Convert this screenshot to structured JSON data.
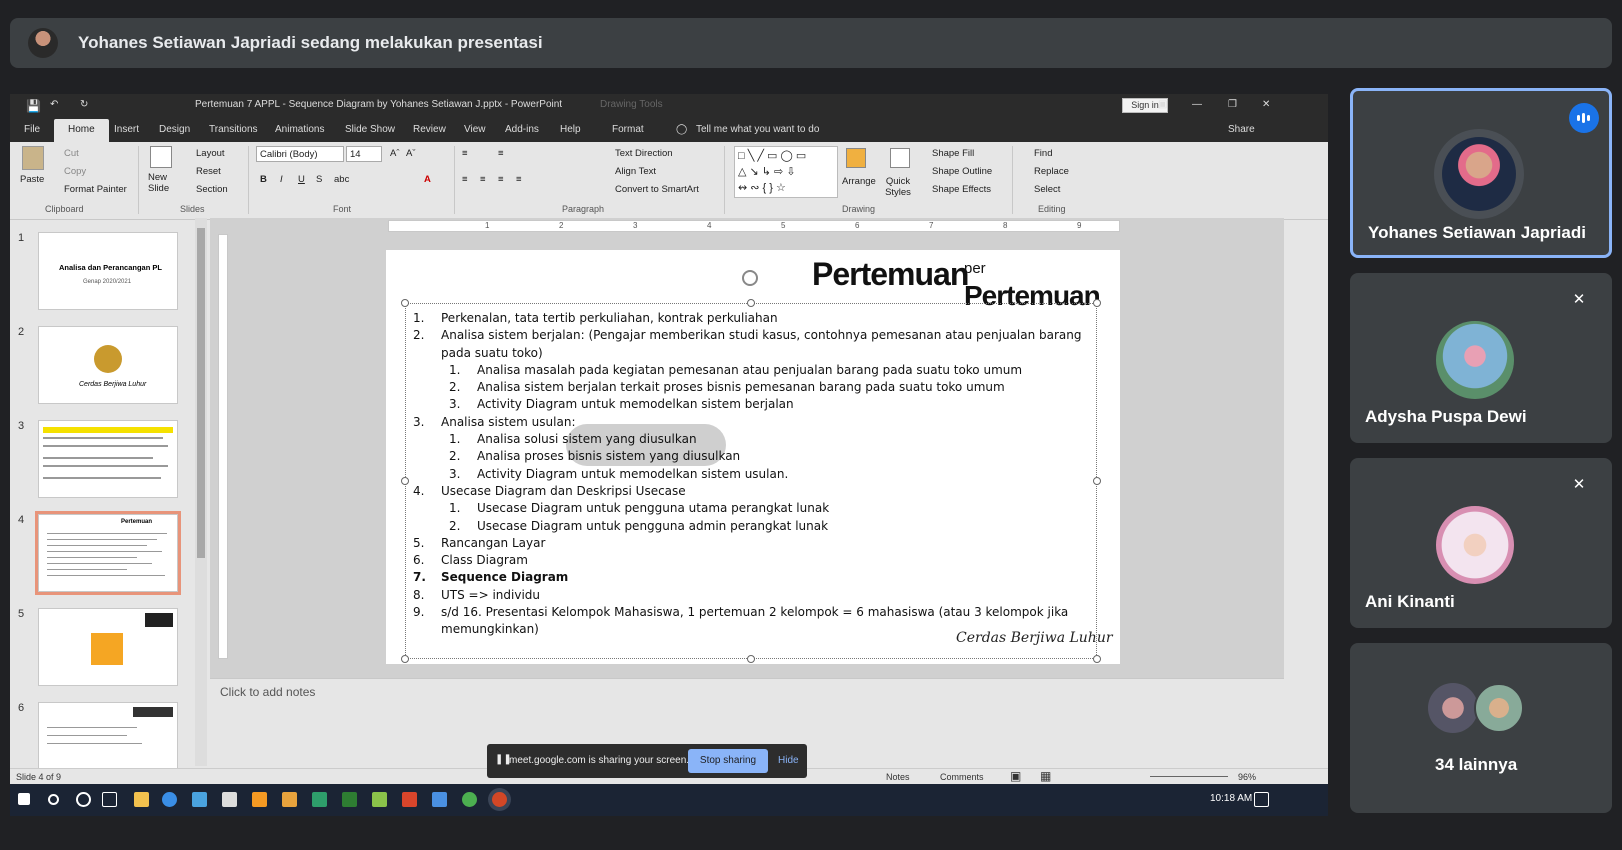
{
  "meet": {
    "presenter_banner": "Yohanes Setiawan Japriadi sedang melakukan presentasi",
    "share_bar": {
      "message": "meet.google.com is sharing your screen.",
      "stop": "Stop sharing",
      "hide": "Hide"
    },
    "participants": [
      {
        "name": "Yohanes Setiawan Japriadi",
        "speaking": true
      },
      {
        "name": "Adysha Puspa Dewi",
        "muted": true
      },
      {
        "name": "Ani Kinanti",
        "muted": true
      },
      {
        "name": "34 lainnya"
      }
    ]
  },
  "ppt": {
    "window_title": "Pertemuan 7 APPL - Sequence Diagram by Yohanes Setiawan J.pptx  -  PowerPoint",
    "drawing_tools": "Drawing Tools",
    "sign_in": "Sign in",
    "tabs": [
      "File",
      "Home",
      "Insert",
      "Design",
      "Transitions",
      "Animations",
      "Slide Show",
      "Review",
      "View",
      "Add-ins",
      "Help",
      "Format"
    ],
    "tell_me": "Tell me what you want to do",
    "share": "Share",
    "ribbon": {
      "cut": "Cut",
      "copy": "Copy",
      "format_painter": "Format Painter",
      "paste": "Paste",
      "new_slide": "New Slide",
      "layout": "Layout",
      "reset": "Reset",
      "section": "Section",
      "font_name": "Calibri (Body)",
      "font_size": "14",
      "text_direction": "Text Direction",
      "align_text": "Align Text",
      "convert": "Convert to SmartArt",
      "arrange": "Arrange",
      "quick_styles": "Quick Styles",
      "shape_fill": "Shape Fill",
      "shape_outline": "Shape Outline",
      "shape_effects": "Shape Effects",
      "find": "Find",
      "replace": "Replace",
      "select": "Select",
      "groups": [
        "Clipboard",
        "Slides",
        "Font",
        "Paragraph",
        "Drawing",
        "Editing"
      ]
    },
    "thumb_numbers": [
      "1",
      "2",
      "3",
      "4",
      "5",
      "6"
    ],
    "thumb1_title": "Analisa dan Perancangan PL",
    "thumb1_sub": "Genap 2020/2021",
    "thumb2_text": "Cerdas Berjiwa Luhur",
    "ruler_marks": [
      "1",
      "2",
      "3",
      "4",
      "5",
      "6",
      "7",
      "8",
      "9"
    ],
    "slide": {
      "title_main": "Pertemuan",
      "title_per": "per",
      "title_second": "Pertemuan",
      "items": [
        {
          "n": "1.",
          "text": "Perkenalan, tata tertib perkuliahan, kontrak perkuliahan",
          "level": 1
        },
        {
          "n": "2.",
          "text": "Analisa sistem berjalan: (Pengajar memberikan studi kasus, contohnya pemesanan atau penjualan barang pada suatu toko)",
          "level": 1
        },
        {
          "n": "1.",
          "text": "Analisa masalah pada kegiatan pemesanan atau penjualan barang pada suatu toko umum",
          "level": 2
        },
        {
          "n": "2.",
          "text": "Analisa sistem berjalan terkait proses bisnis pemesanan barang pada suatu toko umum",
          "level": 2
        },
        {
          "n": "3.",
          "text": "Activity Diagram untuk memodelkan sistem berjalan",
          "level": 2
        },
        {
          "n": "3.",
          "text": "Analisa sistem usulan:",
          "level": 1
        },
        {
          "n": "1.",
          "text": "Analisa solusi sistem yang diusulkan",
          "level": 2
        },
        {
          "n": "2.",
          "text": "Analisa proses bisnis sistem yang diusulkan",
          "level": 2
        },
        {
          "n": "3.",
          "text": "Activity Diagram untuk memodelkan sistem usulan.",
          "level": 2
        },
        {
          "n": "4.",
          "text": "Usecase Diagram dan Deskripsi Usecase",
          "level": 1
        },
        {
          "n": "1.",
          "text": "Usecase Diagram untuk pengguna utama perangkat lunak",
          "level": 2
        },
        {
          "n": "2.",
          "text": "Usecase Diagram untuk pengguna admin perangkat lunak",
          "level": 2
        },
        {
          "n": "5.",
          "text": "Rancangan Layar",
          "level": 1
        },
        {
          "n": "6.",
          "text": "Class Diagram",
          "level": 1
        },
        {
          "n": "7.",
          "text": "Sequence Diagram",
          "level": 1,
          "bold": true
        },
        {
          "n": "8.",
          "text": "UTS => individu",
          "level": 1
        },
        {
          "n": "9.",
          "text": "s/d 16. Presentasi Kelompok Mahasiswa, 1 pertemuan 2 kelompok = 6 mahasiswa (atau 3 kelompok jika memungkinkan)",
          "level": 1
        }
      ],
      "signature": "Cerdas Berjiwa Luhur"
    },
    "notes_placeholder": "Click to add notes",
    "status": {
      "slide": "Slide 4 of 9",
      "notes": "Notes",
      "comments": "Comments",
      "zoom": "96%"
    },
    "clock": "10:18 AM"
  }
}
